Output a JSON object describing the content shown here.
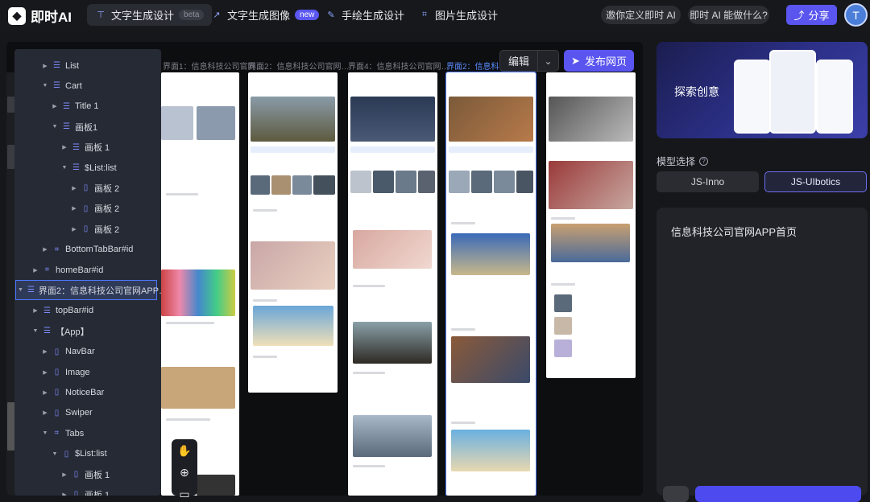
{
  "app": {
    "name": "即时AI",
    "logo_icon": "fox-logo-icon"
  },
  "nav": [
    {
      "label": "文字生成设计",
      "badge": "beta",
      "active": true,
      "icon": "text-design-icon"
    },
    {
      "label": "文字生成图像",
      "badge": "new",
      "active": false,
      "icon": "image-gen-icon"
    },
    {
      "label": "手绘生成设计",
      "badge": "",
      "active": false,
      "icon": "hand-draw-icon"
    },
    {
      "label": "图片生成设计",
      "badge": "",
      "active": false,
      "icon": "image-design-icon"
    }
  ],
  "header": {
    "invite_label": "邀你定义即时 AI",
    "help_label": "即时 AI 能做什么?",
    "share_label": "分享",
    "avatar_initial": "T"
  },
  "canvas": {
    "frame_labels": [
      {
        "text": "界面1：信息科技公司官网…",
        "selected": false
      },
      {
        "text": "界面2：信息科技公司官网…",
        "selected": false
      },
      {
        "text": "界面4：信息科技公司官网…",
        "selected": false
      },
      {
        "text": "界面2：信息科",
        "selected": true
      }
    ],
    "edit_label": "编辑",
    "publish_label": "发布网页"
  },
  "tree": {
    "nodes": [
      {
        "label": "List",
        "depth": 3,
        "icon": "list-icon",
        "caret": "right"
      },
      {
        "label": "Cart",
        "depth": 3,
        "icon": "list-icon",
        "caret": "down"
      },
      {
        "label": "Title 1",
        "depth": 4,
        "icon": "list-icon",
        "caret": "right"
      },
      {
        "label": "画板1",
        "depth": 4,
        "icon": "list-icon",
        "caret": "down"
      },
      {
        "label": "画板 1",
        "depth": 5,
        "icon": "list-icon",
        "caret": "right"
      },
      {
        "label": "$List:list",
        "depth": 5,
        "icon": "list-icon",
        "caret": "down"
      },
      {
        "label": "画板 2",
        "depth": 6,
        "icon": "frame-icon",
        "caret": "right"
      },
      {
        "label": "画板 2",
        "depth": 6,
        "icon": "frame-icon",
        "caret": "right"
      },
      {
        "label": "画板 2",
        "depth": 6,
        "icon": "frame-icon",
        "caret": "right"
      },
      {
        "label": "BottomTabBar#id",
        "depth": 3,
        "icon": "hash-icon",
        "caret": "right"
      },
      {
        "label": "homeBar#id",
        "depth": 2,
        "icon": "hash-icon",
        "caret": "right"
      },
      {
        "label": "界面2：信息科技公司官网APP…",
        "depth": 1,
        "icon": "list-icon",
        "caret": "down",
        "selected": true
      },
      {
        "label": "topBar#id",
        "depth": 2,
        "icon": "list-icon",
        "caret": "right"
      },
      {
        "label": "【App】",
        "depth": 2,
        "icon": "list-icon",
        "caret": "down"
      },
      {
        "label": "NavBar",
        "depth": 3,
        "icon": "frame-icon",
        "caret": "right"
      },
      {
        "label": "Image",
        "depth": 3,
        "icon": "frame-icon",
        "caret": "right"
      },
      {
        "label": "NoticeBar",
        "depth": 3,
        "icon": "frame-icon",
        "caret": "right"
      },
      {
        "label": "Swiper",
        "depth": 3,
        "icon": "frame-icon",
        "caret": "right"
      },
      {
        "label": "Tabs",
        "depth": 3,
        "icon": "hash-icon",
        "caret": "down"
      },
      {
        "label": "$List:list",
        "depth": 4,
        "icon": "frame-icon",
        "caret": "down"
      },
      {
        "label": "画板 1",
        "depth": 5,
        "icon": "frame-icon",
        "caret": "right"
      },
      {
        "label": "画板 1",
        "depth": 5,
        "icon": "frame-icon",
        "caret": "right"
      }
    ]
  },
  "right": {
    "banner_text": "探索创意",
    "model_label": "模型选择",
    "models": [
      {
        "label": "JS-Inno",
        "selected": false
      },
      {
        "label": "JS-UIbotics",
        "selected": true
      }
    ],
    "prompt": "信息科技公司官网APP首页"
  },
  "colors": {
    "accent": "#5a55ee",
    "selected_border": "#4d78ff",
    "bg": "#16171b"
  }
}
